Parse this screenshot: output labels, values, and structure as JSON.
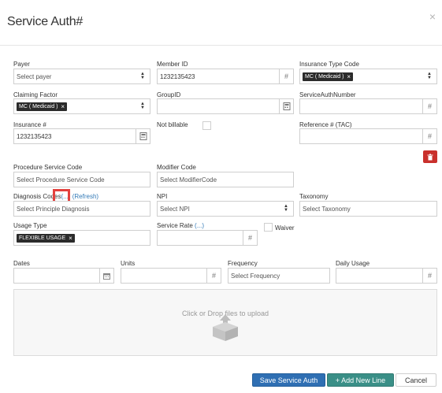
{
  "modal": {
    "title": "Service Auth#"
  },
  "fields": {
    "payer": {
      "label": "Payer",
      "placeholder": "Select payer"
    },
    "member_id": {
      "label": "Member ID",
      "value": "1232135423",
      "addon": "#"
    },
    "insurance_type_code": {
      "label": "Insurance Type Code",
      "tag": "MC ( Medicaid )"
    },
    "claiming_factor": {
      "label": "Claiming Factor",
      "tag": "MC ( Medicaid )"
    },
    "group_id": {
      "label": "GroupID"
    },
    "service_auth_number": {
      "label": "ServiceAuthNumber",
      "addon": "#"
    },
    "insurance_num": {
      "label": "Insurance #",
      "value": "1232135423"
    },
    "not_billable": {
      "label": "Not billable"
    },
    "reference_tac": {
      "label": "Reference # (TAC)",
      "addon": "#"
    },
    "procedure_service_code": {
      "label": "Procedure Service Code",
      "placeholder": "Select Procedure Service Code"
    },
    "modifier_code": {
      "label": "Modifier Code",
      "placeholder": "Select ModifierCode"
    },
    "diagnosis_codes": {
      "label": "Diagnosis Codes",
      "link_more": "(...)",
      "link_refresh": "(Refresh)",
      "placeholder": "Select Principle Diagnosis"
    },
    "npi": {
      "label": "NPI",
      "placeholder": "Select NPI"
    },
    "taxonomy": {
      "label": "Taxonomy",
      "placeholder": "Select Taxonomy"
    },
    "usage_type": {
      "label": "Usage Type",
      "tag": "FLEXIBLE USAGE"
    },
    "service_rate": {
      "label": "Service Rate",
      "link": "(...)",
      "addon": "#"
    },
    "waiver": {
      "label": "Waiver"
    },
    "dates": {
      "label": "Dates"
    },
    "units": {
      "label": "Units",
      "addon": "#"
    },
    "frequency": {
      "label": "Frequency",
      "placeholder": "Select Frequency"
    },
    "daily_usage": {
      "label": "Daily Usage",
      "addon": "#"
    }
  },
  "upload": {
    "text": "Click or Drop files to upload"
  },
  "footer": {
    "save_label": "Save Service Auth",
    "add_line_label": "+ Add New Line",
    "cancel_label": "Cancel"
  },
  "icons": {
    "close": "close-icon",
    "calendar": "calendar-icon",
    "trash": "trash-icon",
    "calculator": "calculator-icon",
    "upload": "upload-box-icon"
  },
  "colors": {
    "primary": "#2f6fb3",
    "success": "#3a8f87",
    "danger": "#c9302c",
    "highlight": "#e3413e",
    "tag": "#2b2b2b"
  }
}
